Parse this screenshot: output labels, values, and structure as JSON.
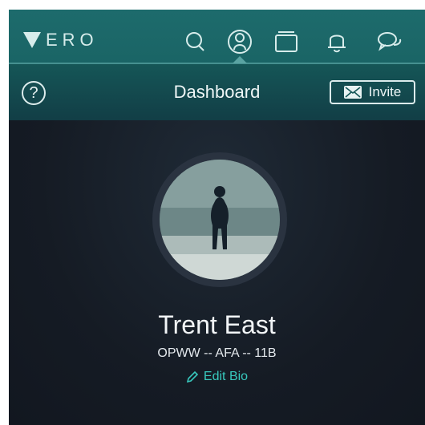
{
  "header": {
    "logo_text": "ERO",
    "nav_icons": [
      "search-icon",
      "profile-icon",
      "collections-icon",
      "notifications-icon",
      "chat-icon"
    ],
    "active_nav": "profile-icon"
  },
  "subheader": {
    "help_glyph": "?",
    "title": "Dashboard",
    "invite_label": "Invite"
  },
  "profile": {
    "name": "Trent East",
    "bio": "OPWW -- AFA -- 11B",
    "edit_bio_label": "Edit Bio"
  },
  "colors": {
    "header_bg": "#1d6b6c",
    "content_bg": "#151b24",
    "accent": "#38c8bd",
    "icon_stroke": "#d7eceb"
  }
}
